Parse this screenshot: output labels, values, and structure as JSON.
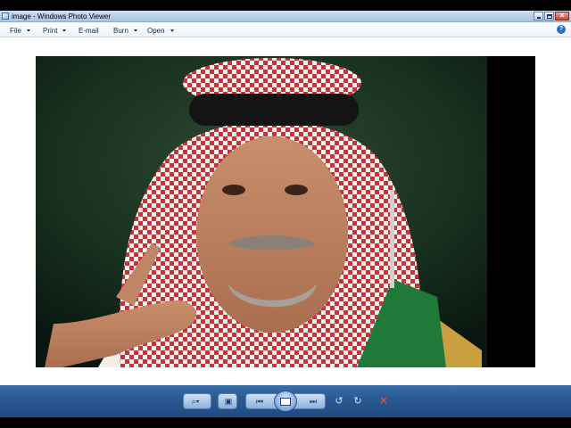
{
  "window": {
    "title": "image - Windows Photo Viewer"
  },
  "menu": {
    "items": [
      {
        "label": "File",
        "has_dropdown": true
      },
      {
        "label": "Print",
        "has_dropdown": true
      },
      {
        "label": "E-mail",
        "has_dropdown": false
      },
      {
        "label": "Burn",
        "has_dropdown": true
      },
      {
        "label": "Open",
        "has_dropdown": true
      }
    ],
    "help_label": "?"
  },
  "photo": {
    "description_icon": "photo-of-man-in-red-white-keffiyeh"
  },
  "controls": {
    "zoom_icon": "magnifier-icon",
    "fit_icon": "actual-size-icon",
    "prev_icon": "previous-icon",
    "slideshow_icon": "slideshow-icon",
    "next_icon": "next-icon",
    "rotate_ccw_icon": "rotate-counterclockwise-icon",
    "rotate_cw_icon": "rotate-clockwise-icon",
    "delete_icon": "delete-icon"
  },
  "colors": {
    "titlebar": "#b9d1ea",
    "controlbar": "#2a5a94",
    "delete": "#e05030"
  }
}
